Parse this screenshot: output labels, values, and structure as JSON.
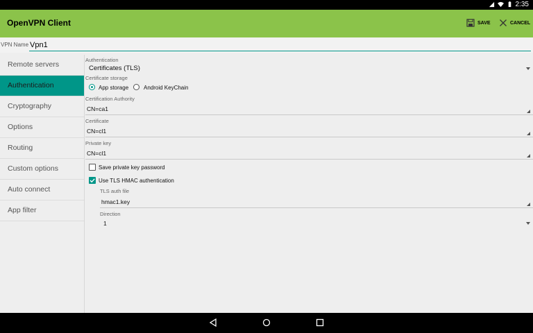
{
  "status_bar": {
    "time": "2:35",
    "icons": [
      "signal-icon",
      "wifi-icon",
      "battery-icon"
    ]
  },
  "app_bar": {
    "title": "OpenVPN Client",
    "save_label": "SAVE",
    "cancel_label": "CANCEL",
    "color": "#8bc34a"
  },
  "vpn_name": {
    "label": "VPN Name",
    "value": "Vpn1"
  },
  "sidebar": {
    "accent": "#009688",
    "items": [
      {
        "label": "Remote servers",
        "active": false
      },
      {
        "label": "Authentication",
        "active": true
      },
      {
        "label": "Cryptography",
        "active": false
      },
      {
        "label": "Options",
        "active": false
      },
      {
        "label": "Routing",
        "active": false
      },
      {
        "label": "Custom options",
        "active": false
      },
      {
        "label": "Auto connect",
        "active": false
      },
      {
        "label": "App filter",
        "active": false
      }
    ]
  },
  "auth": {
    "authentication_label": "Authentication",
    "authentication_value": "Certificates (TLS)",
    "storage_label": "Certificate storage",
    "storage_options": [
      "App storage",
      "Android KeyChain"
    ],
    "storage_selected": "App storage",
    "ca_label": "Certification Authority",
    "ca_value": "CN=ca1",
    "cert_label": "Certificate",
    "cert_value": "CN=cl1",
    "key_label": "Private key",
    "key_value": "CN=cl1",
    "save_password_label": "Save private key password",
    "save_password_checked": false,
    "tls_hmac_label": "Use TLS HMAC authentication",
    "tls_hmac_checked": true,
    "tls_auth_file_label": "TLS auth file",
    "tls_auth_file_value": "hmac1.key",
    "direction_label": "Direction",
    "direction_value": "1"
  }
}
